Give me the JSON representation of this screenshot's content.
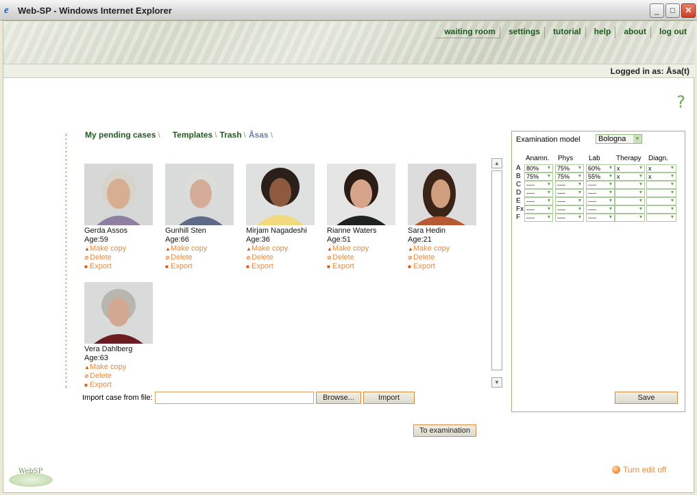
{
  "window": {
    "title": "Web-SP - Windows Internet Explorer"
  },
  "nav": [
    "waiting room",
    "settings",
    "tutorial",
    "help",
    "about",
    "log out"
  ],
  "login": {
    "text": "Logged in as: Åsa(t)"
  },
  "help_icon": "?",
  "tabs": [
    "My pending cases",
    "Templates",
    "Trash",
    "Åsas"
  ],
  "actions": {
    "copy": "Make copy",
    "delete": "Delete",
    "export": "Export"
  },
  "cases": [
    {
      "name": "Gerda Assos",
      "age": "Age:59"
    },
    {
      "name": "Gunhill Sten",
      "age": "Age:66"
    },
    {
      "name": "Mirjam Nagadeshi",
      "age": "Age:36"
    },
    {
      "name": "Rianne Waters",
      "age": "Age:51"
    },
    {
      "name": "Sara Hedin",
      "age": "Age:21"
    },
    {
      "name": "Vera Dahlberg",
      "age": "Age:63"
    }
  ],
  "import": {
    "label": "Import case from file:",
    "browse": "Browse...",
    "import": "Import"
  },
  "to_exam": "To examination",
  "exam": {
    "label": "Examination model",
    "model": "Bologna",
    "columns": [
      "Anamn.",
      "Phys",
      "Lab",
      "Therapy",
      "Diagn."
    ],
    "rows": [
      {
        "grade": "A",
        "values": [
          "80%",
          "75%",
          "60%",
          "x",
          "x"
        ]
      },
      {
        "grade": "B",
        "values": [
          "75%",
          "75%",
          "55%",
          "x",
          "x"
        ]
      },
      {
        "grade": "C",
        "values": [
          "----",
          "----",
          "----",
          "",
          ""
        ]
      },
      {
        "grade": "D",
        "values": [
          "----",
          "----",
          "----",
          "",
          ""
        ]
      },
      {
        "grade": "E",
        "values": [
          "----",
          "----",
          "----",
          "",
          ""
        ]
      },
      {
        "grade": "Fx",
        "values": [
          "----",
          "----",
          "----",
          "",
          ""
        ]
      },
      {
        "grade": "F",
        "values": [
          "----",
          "----",
          "----",
          "",
          ""
        ]
      }
    ],
    "save": "Save"
  },
  "logo": "WebSP",
  "edit_toggle": "Turn edit off"
}
